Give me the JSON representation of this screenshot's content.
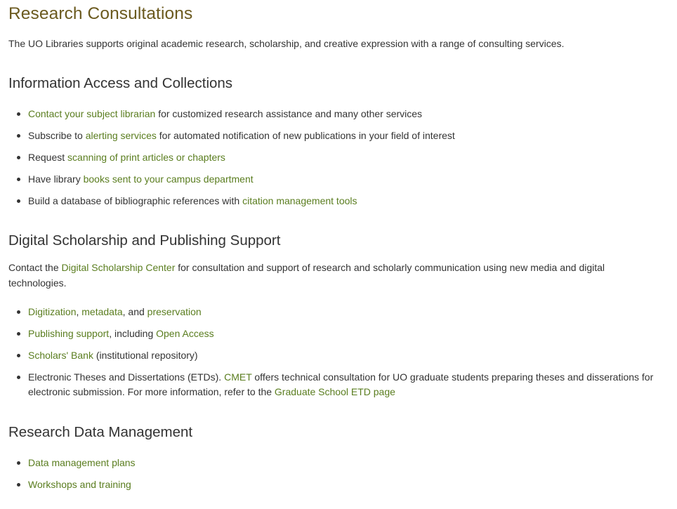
{
  "page_title": "Research Consultations",
  "intro": "The UO Libraries supports original academic research, scholarship, and creative expression with a range of consulting services.",
  "colors": {
    "title": "#6b5a1f",
    "link": "#5a7d1f",
    "text": "#333333",
    "background": "#ffffff"
  },
  "sections": {
    "info_access": {
      "heading": "Information Access and Collections",
      "items": [
        {
          "link": "Contact your subject librarian",
          "after": " for customized research assistance and many other services"
        },
        {
          "before": "Subscribe to ",
          "link": "alerting services",
          "after": " for automated notification of new publications in your field of interest"
        },
        {
          "before": "Request ",
          "link": "scanning of print articles or chapters"
        },
        {
          "before": "Have library ",
          "link": "books sent to your campus department"
        },
        {
          "before": "Build a database of bibliographic references with ",
          "link": "citation management tools"
        }
      ]
    },
    "digital": {
      "heading": "Digital Scholarship and Publishing Support",
      "intro_before": "Contact the ",
      "intro_link": "Digital Scholarship Center",
      "intro_after": " for consultation and support of research and scholarly communication using new media and digital technologies.",
      "items": {
        "digitization": {
          "link1": "Digitization",
          "sep1": ", ",
          "link2": "metadata",
          "sep2": ", and ",
          "link3": "preservation"
        },
        "publishing": {
          "link1": "Publishing support",
          "sep": ", including ",
          "link2": "Open Access"
        },
        "scholars_bank": {
          "link": "Scholars' Bank",
          "after": " (institutional repository)"
        },
        "etd": {
          "before": "Electronic Theses and Dissertations (ETDs). ",
          "link1": "CMET",
          "middle": " offers technical consultation for UO graduate students preparing theses and disserations for electronic submission. For more information, refer to the ",
          "link2": "Graduate School ETD page"
        }
      }
    },
    "rdm": {
      "heading": "Research Data Management",
      "items": [
        {
          "link": "Data management plans"
        },
        {
          "link": "Workshops and training"
        }
      ]
    }
  }
}
